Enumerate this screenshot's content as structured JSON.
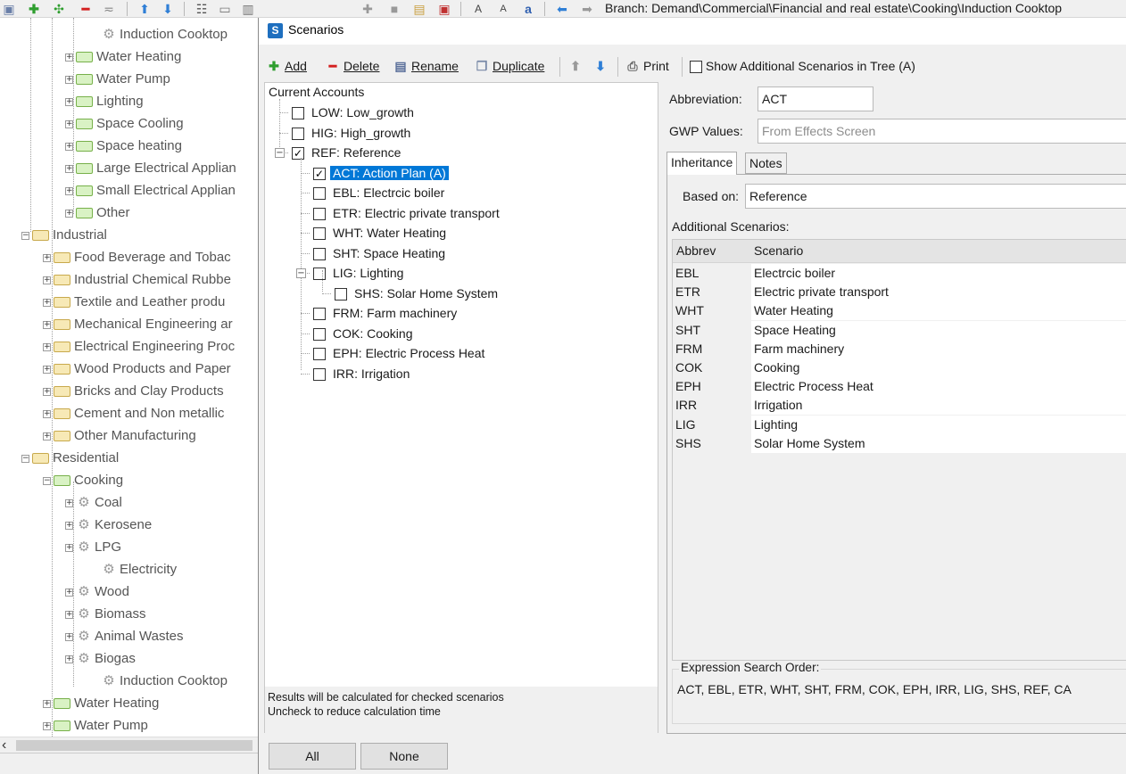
{
  "main_toolbar": {
    "branch_text": "Branch: Demand\\Commercial\\Financial and real estate\\Cooking\\Induction Cooktop"
  },
  "tree": {
    "items": [
      {
        "label": "Induction Cooktop",
        "kind": "gear"
      },
      {
        "label": "Water Heating",
        "kind": "folder-green"
      },
      {
        "label": "Water Pump",
        "kind": "folder-green"
      },
      {
        "label": "Lighting",
        "kind": "folder-green"
      },
      {
        "label": "Space Cooling",
        "kind": "folder-green"
      },
      {
        "label": "Space heating",
        "kind": "folder-green"
      },
      {
        "label": "Large Electrical Applian",
        "kind": "folder-green"
      },
      {
        "label": "Small Electrical Applian",
        "kind": "folder-green"
      },
      {
        "label": "Other",
        "kind": "folder-green"
      },
      {
        "label": "Industrial",
        "kind": "folder"
      },
      {
        "label": "Food Beverage and Tobac",
        "kind": "folder"
      },
      {
        "label": "Industrial Chemical Rubbe",
        "kind": "folder"
      },
      {
        "label": "Textile and Leather produ",
        "kind": "folder"
      },
      {
        "label": "Mechanical Engineering ar",
        "kind": "folder"
      },
      {
        "label": "Electrical Engineering Proc",
        "kind": "folder"
      },
      {
        "label": "Wood Products and Paper",
        "kind": "folder"
      },
      {
        "label": "Bricks and Clay Products",
        "kind": "folder"
      },
      {
        "label": "Cement and Non metallic",
        "kind": "folder"
      },
      {
        "label": "Other Manufacturing",
        "kind": "folder"
      },
      {
        "label": "Residential",
        "kind": "folder"
      },
      {
        "label": "Cooking",
        "kind": "folder-green"
      },
      {
        "label": "Coal",
        "kind": "gear"
      },
      {
        "label": "Kerosene",
        "kind": "gear"
      },
      {
        "label": "LPG",
        "kind": "gear"
      },
      {
        "label": "Electricity",
        "kind": "gear"
      },
      {
        "label": "Wood",
        "kind": "gear"
      },
      {
        "label": "Biomass",
        "kind": "gear"
      },
      {
        "label": "Animal Wastes",
        "kind": "gear"
      },
      {
        "label": "Biogas",
        "kind": "gear"
      },
      {
        "label": "Induction Cooktop",
        "kind": "gear"
      },
      {
        "label": "Water Heating",
        "kind": "folder-green"
      },
      {
        "label": "Water Pump",
        "kind": "folder-green"
      }
    ]
  },
  "dialog": {
    "title": "Scenarios",
    "title_icon_letter": "S",
    "toolbar": {
      "add": "Add",
      "delete": "Delete",
      "rename": "Rename",
      "duplicate": "Duplicate",
      "print": "Print",
      "show_additional": "Show Additional Scenarios in Tree (A)"
    },
    "scenario_tree": {
      "root": "Current Accounts",
      "items": [
        {
          "label": "LOW: Low_growth",
          "checked": false
        },
        {
          "label": "HIG: High_growth",
          "checked": false
        },
        {
          "label": "REF: Reference",
          "checked": true
        },
        {
          "label": "ACT: Action Plan (A)",
          "checked": true
        },
        {
          "label": "EBL: Electrcic boiler",
          "checked": false
        },
        {
          "label": "ETR: Electric private transport",
          "checked": false
        },
        {
          "label": "WHT: Water Heating",
          "checked": false
        },
        {
          "label": "SHT: Space Heating",
          "checked": false
        },
        {
          "label": "LIG: Lighting",
          "checked": false
        },
        {
          "label": "SHS: Solar Home System",
          "checked": false
        },
        {
          "label": "FRM: Farm machinery",
          "checked": false
        },
        {
          "label": "COK: Cooking",
          "checked": false
        },
        {
          "label": "EPH: Electric Process Heat",
          "checked": false
        },
        {
          "label": "IRR: Irrigation",
          "checked": false
        }
      ],
      "footnote_line1": "Results will be calculated for checked scenarios",
      "footnote_line2": "Uncheck to reduce calculation time"
    },
    "abbreviation_label": "Abbreviation:",
    "abbreviation_value": "ACT",
    "gwp_label": "GWP Values:",
    "gwp_value": "From Effects Screen",
    "tabs": [
      "Inheritance",
      "Notes"
    ],
    "based_on_label": "Based on:",
    "based_on_value": "Reference",
    "additional_label": "Additional Scenarios:",
    "additional_table": {
      "col_abbrev": "Abbrev",
      "col_scenario": "Scenario",
      "rows": [
        {
          "abbrev": "EBL",
          "scenario": "Electrcic boiler"
        },
        {
          "abbrev": "ETR",
          "scenario": "Electric private transport"
        },
        {
          "abbrev": "WHT",
          "scenario": "Water Heating"
        },
        {
          "abbrev": "SHT",
          "scenario": "Space Heating"
        },
        {
          "abbrev": "FRM",
          "scenario": "Farm machinery"
        },
        {
          "abbrev": "COK",
          "scenario": "Cooking"
        },
        {
          "abbrev": "EPH",
          "scenario": "Electric Process Heat"
        },
        {
          "abbrev": "IRR",
          "scenario": "Irrigation"
        },
        {
          "abbrev": "LIG",
          "scenario": "Lighting"
        },
        {
          "abbrev": "SHS",
          "scenario": "Solar Home System"
        }
      ]
    },
    "search_order_label": "Expression Search Order:",
    "search_order_value": "ACT, EBL, ETR, WHT, SHT, FRM, COK, EPH, IRR, LIG, SHS, REF, CA",
    "btn_all": "All",
    "btn_none": "None"
  },
  "colors": {
    "selection": "#0078d7",
    "add_icon": "#2e9e2e",
    "delete_icon": "#d42020",
    "arrow_icon": "#2f7fd6"
  }
}
